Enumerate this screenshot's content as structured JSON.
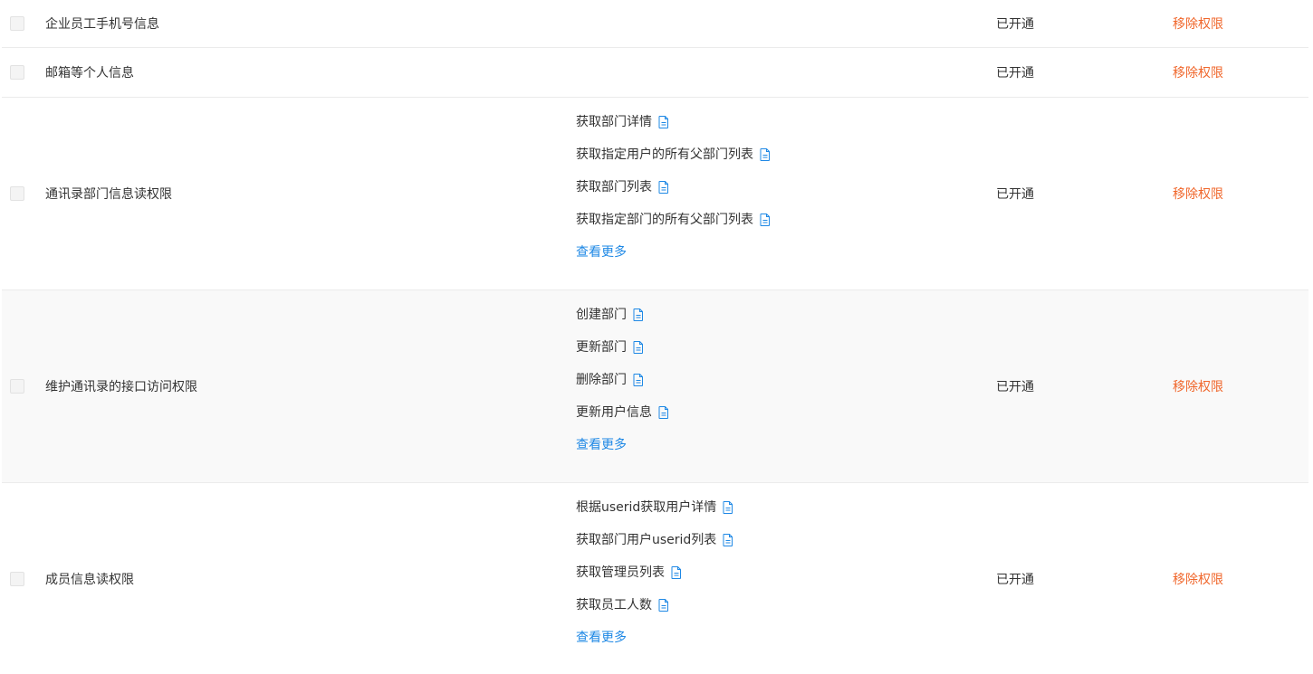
{
  "rows": [
    {
      "name": "企业员工手机号信息",
      "apis": [],
      "more": "",
      "status": "已开通",
      "action": "移除权限"
    },
    {
      "name": "邮箱等个人信息",
      "apis": [],
      "more": "",
      "status": "已开通",
      "action": "移除权限"
    },
    {
      "name": "通讯录部门信息读权限",
      "apis": [
        "获取部门详情",
        "获取指定用户的所有父部门列表",
        "获取部门列表",
        "获取指定部门的所有父部门列表"
      ],
      "more": "查看更多",
      "status": "已开通",
      "action": "移除权限"
    },
    {
      "name": "维护通讯录的接口访问权限",
      "apis": [
        "创建部门",
        "更新部门",
        "删除部门",
        "更新用户信息"
      ],
      "more": "查看更多",
      "status": "已开通",
      "action": "移除权限"
    },
    {
      "name": "成员信息读权限",
      "apis": [
        "根据userid获取用户详情",
        "获取部门用户userid列表",
        "获取管理员列表",
        "获取员工人数"
      ],
      "more": "查看更多",
      "status": "已开通",
      "action": "移除权限"
    }
  ],
  "icons": {
    "api_doc": "document-icon",
    "row_select": "checkbox-icon"
  },
  "colors": {
    "remove_action": "#f0672c",
    "more_link": "#1e88e5",
    "doc_icon": "#1e88e5",
    "highlight_row": "#f9f9f9"
  }
}
